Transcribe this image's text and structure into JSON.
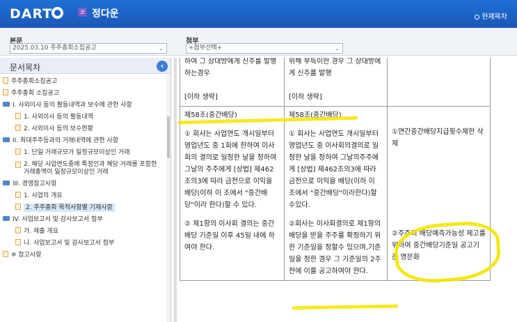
{
  "header": {
    "logo": "DART",
    "company_badge": "코",
    "company_name": "정다운",
    "current_target": "현재목차"
  },
  "selectors": {
    "main_doc_label": "본문",
    "main_doc_value": "2025.03.10  주주총회소집공고",
    "attachment_label": "첨부",
    "attachment_value": "+첨부선택+"
  },
  "toc": {
    "title": "문서목차",
    "items": [
      {
        "type": "doc",
        "level": 0,
        "label": "주주총회소집공고"
      },
      {
        "type": "doc",
        "level": 0,
        "label": "주주총회 소집공고"
      },
      {
        "type": "folder",
        "level": 0,
        "label": "I. 사외이사 등의 활동내역과 보수에 관한 사항"
      },
      {
        "type": "doc",
        "level": 1,
        "label": "1. 사외이사 등의 활동내역"
      },
      {
        "type": "doc",
        "level": 1,
        "label": "2. 사외이사 등의 보수현황"
      },
      {
        "type": "folder",
        "level": 0,
        "label": "II. 최대주주등과의 거래내역에 관한 사항"
      },
      {
        "type": "doc",
        "level": 1,
        "label": "1. 단일 거래규모가 일정규모이상인 거래"
      },
      {
        "type": "doc",
        "level": 1,
        "label": "2. 해당 사업연도중에 특정인과 해당 거래를 포함한 거래총액이 일정규모이상인 거래",
        "two_line": true
      },
      {
        "type": "folder",
        "level": 0,
        "label": "III. 경영참고사항"
      },
      {
        "type": "doc",
        "level": 1,
        "label": "1. 사업의 개요"
      },
      {
        "type": "doc",
        "level": 1,
        "label": "2. 주주총회 목적사항별 기재사항",
        "selected": true
      },
      {
        "type": "folder",
        "level": 0,
        "label": "IV. 사업보고서 및 감사보고서 첨부"
      },
      {
        "type": "doc",
        "level": 1,
        "label": "가. 제출 개요"
      },
      {
        "type": "doc",
        "level": 1,
        "label": "나. 사업보고서 및 감사보고서 첨부"
      },
      {
        "type": "doc",
        "level": 0,
        "label": "※ 참고사항"
      }
    ]
  },
  "content": {
    "row1": {
      "col1": "하여 그 상대방에게 신주를 발행하는경우\n\n[이하 생략]",
      "col2": "위해 부득이한 경우 그 상대방에게 신주를 발행\n\n[이하 생략]",
      "col3": ""
    },
    "row2": {
      "col1_title": "제58조(중간배당)",
      "col1_p1": "① 회사는 사업연도 개시일부터 영업년도 중 1회에 한하여 이사회의 결의로 일정한 날을 정하여 그날의 주주에게 [상법] 제462조의3에 따라 금전으로 이익을 배당(이하 이 조에서 \"중간배당\"이라 한다)할 수 있다.",
      "col1_p2": "② 제1항의 이사회 결의는 중간배당 기준일 이후 45일 내에 하여야 한다.",
      "col2_title": "제58조(중간배당)",
      "col2_p1": "① 회사는 사업연도 개시일부터 영업년도 중 이사회의결의로 일정한 날을 정하여 그날의주주에게 [상법] 제462조의3에 따라 금전으로 이익을 배당(이하 이 조에서 \"중간배당\"이라한다)할수있다.",
      "col2_p2": "②회사는 이사회결의로 제1항의 배당을 받을 주주를 확정하기 위한 기준일을 정할수 있으며,기준일을 정한 경우 그 기준일의 2주전에 이를 공고하여야 한다.",
      "col3_p1": "①연간중간배당지급횟수제한 삭제",
      "col3_p2": "②주주의 배당예측가능성 제고를 위하여 중간배당기준일 공고기준 명문화"
    }
  },
  "colors": {
    "header_bg": "#1a5fc4",
    "highlighter": "#f4e400",
    "selected_item_bg": "#d6e7f7"
  }
}
